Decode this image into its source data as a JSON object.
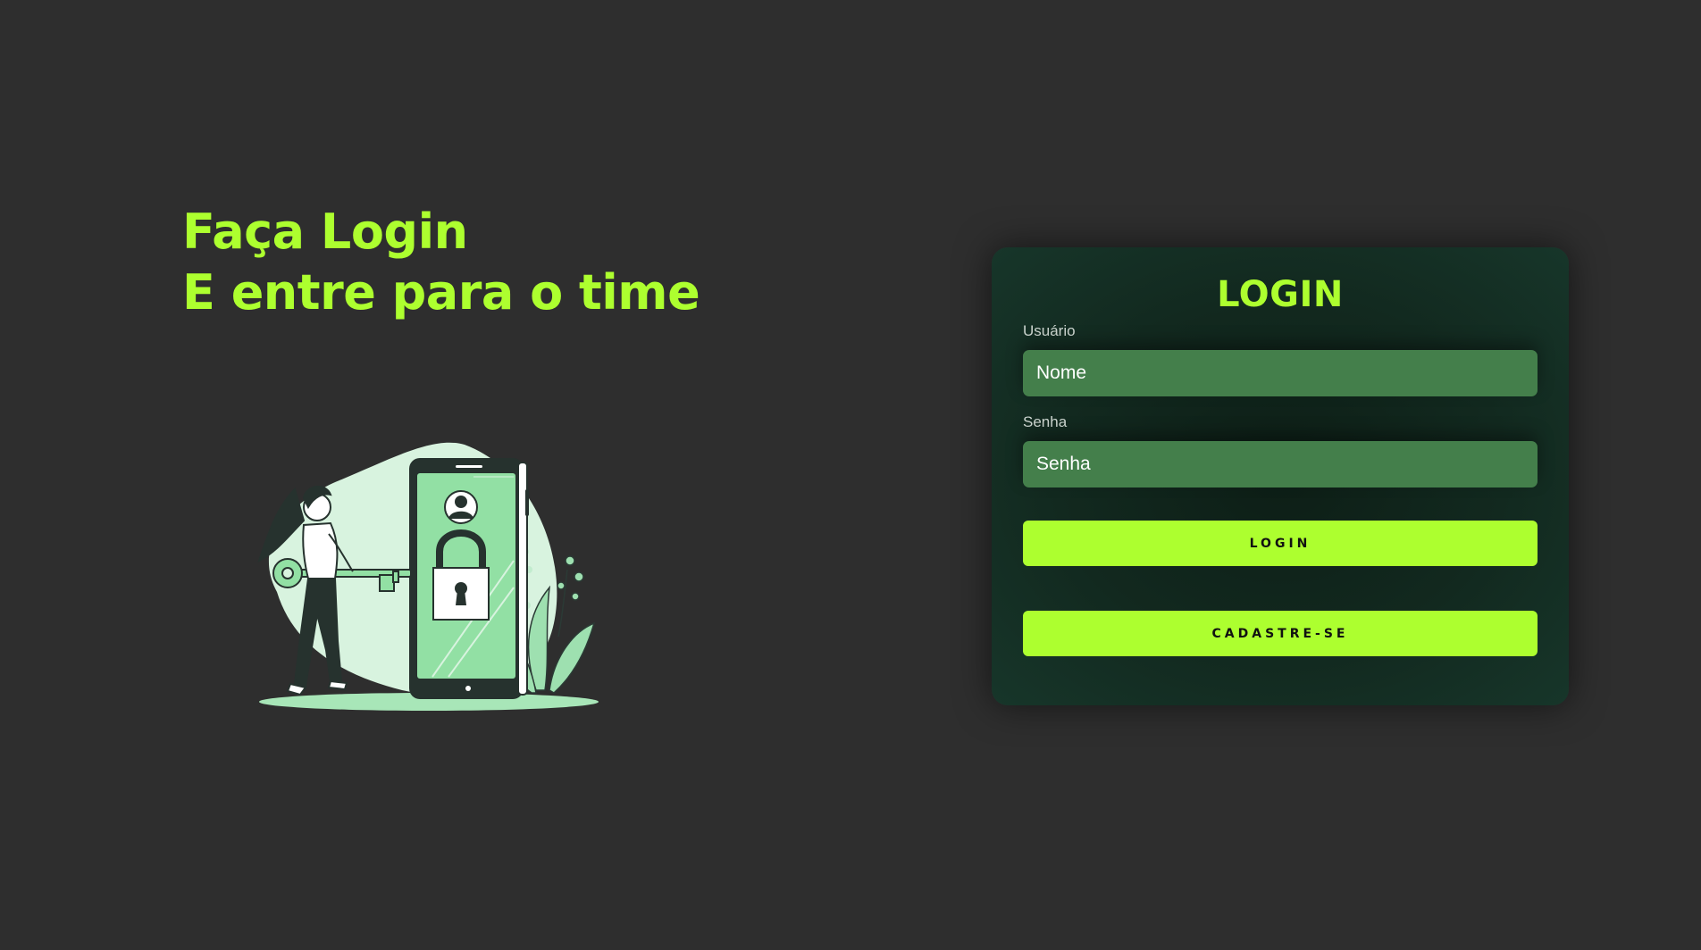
{
  "hero": {
    "line1": "Faça Login",
    "line2": "E entre para o time"
  },
  "illustration": {
    "icon": "phone-lock-key-illustration"
  },
  "login_card": {
    "title": "LOGIN",
    "username": {
      "label": "Usuário",
      "placeholder": "Nome"
    },
    "password": {
      "label": "Senha",
      "placeholder": "Senha"
    },
    "login_button": "LOGIN",
    "signup_button": "CADASTRE-SE"
  },
  "colors": {
    "background": "#2e2e2e",
    "accent": "#adff2f",
    "card": "#12291f",
    "input": "#447f4b"
  }
}
